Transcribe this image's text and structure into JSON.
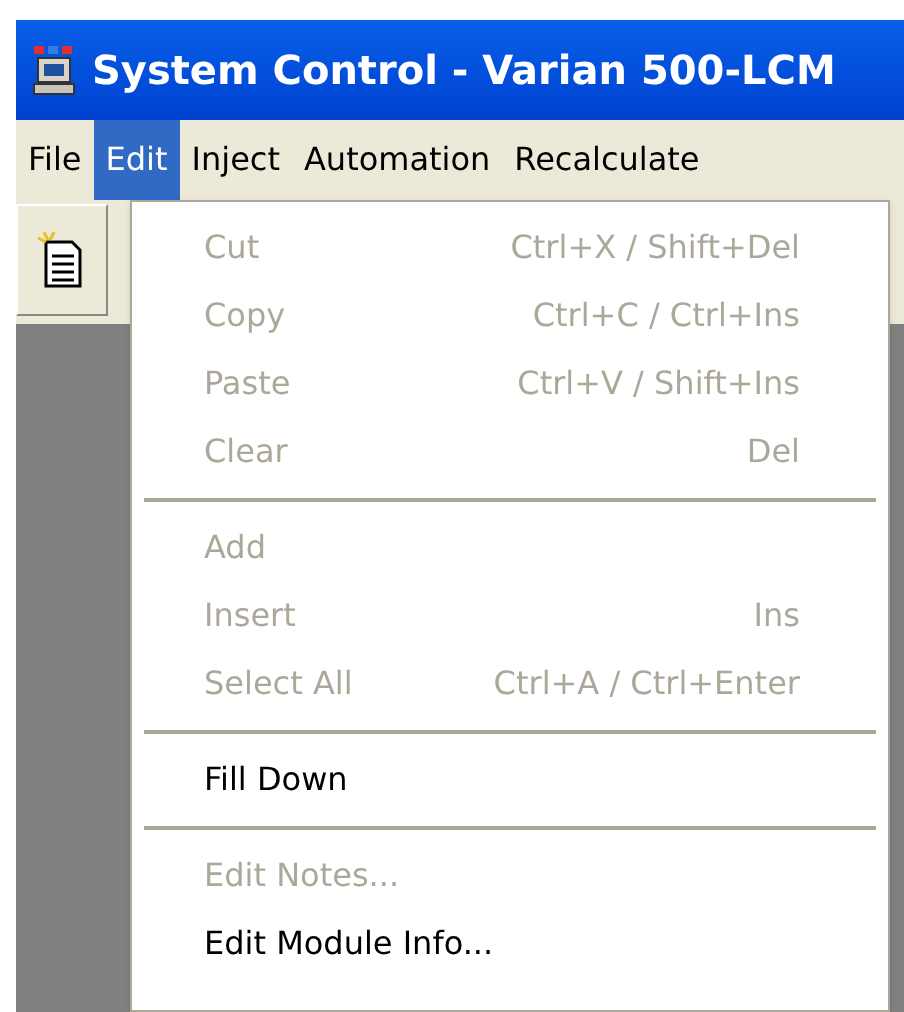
{
  "window": {
    "title": "System Control - Varian 500-LCM"
  },
  "menu_bar": [
    {
      "label": "File",
      "selected": false
    },
    {
      "label": "Edit",
      "selected": true
    },
    {
      "label": "Inject",
      "selected": false
    },
    {
      "label": "Automation",
      "selected": false
    },
    {
      "label": "Recalculate",
      "selected": false
    }
  ],
  "edit_menu": {
    "groups": [
      [
        {
          "label": "Cut",
          "shortcut": "Ctrl+X / Shift+Del",
          "disabled": true
        },
        {
          "label": "Copy",
          "shortcut": "Ctrl+C / Ctrl+Ins",
          "disabled": true
        },
        {
          "label": "Paste",
          "shortcut": "Ctrl+V / Shift+Ins",
          "disabled": true
        },
        {
          "label": "Clear",
          "shortcut": "Del",
          "disabled": true
        }
      ],
      [
        {
          "label": "Add",
          "disabled": true
        },
        {
          "label": "Insert",
          "shortcut": "Ins",
          "disabled": true
        },
        {
          "label": "Select All",
          "shortcut": "Ctrl+A / Ctrl+Enter",
          "disabled": true
        }
      ],
      [
        {
          "label": "Fill Down",
          "disabled": false
        }
      ],
      [
        {
          "label": "Edit Notes...",
          "disabled": true
        },
        {
          "label": "Edit Module Info...",
          "disabled": false
        }
      ]
    ]
  }
}
